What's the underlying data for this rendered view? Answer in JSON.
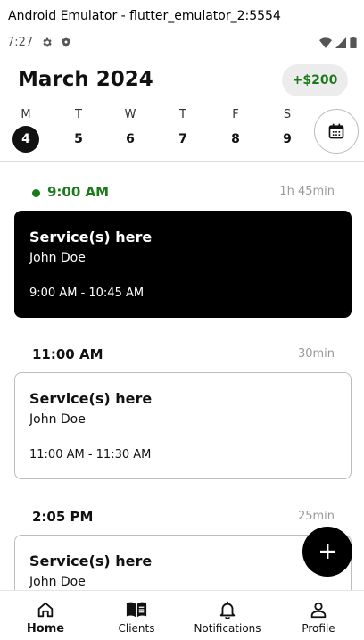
{
  "window": {
    "title": "Android Emulator - flutter_emulator_2:5554"
  },
  "status_bar": {
    "time": "7:27",
    "icons": [
      "gear-icon",
      "shield-icon",
      "wifi-icon",
      "signal-icon",
      "battery-icon"
    ]
  },
  "header": {
    "month": "March 2024",
    "balance": "+$200"
  },
  "week": {
    "days": [
      {
        "letter": "M",
        "num": "4",
        "active": true
      },
      {
        "letter": "T",
        "num": "5"
      },
      {
        "letter": "W",
        "num": "6"
      },
      {
        "letter": "T",
        "num": "7"
      },
      {
        "letter": "F",
        "num": "8"
      },
      {
        "letter": "S",
        "num": "9"
      }
    ],
    "calendar_icon": "calendar-icon"
  },
  "appointments": [
    {
      "time": "9:00 AM",
      "duration": "1h 45min",
      "service": "Service(s) here",
      "client": "John Doe",
      "range": "9:00 AM - 10:45 AM",
      "current": true
    },
    {
      "time": "11:00 AM",
      "duration": "30min",
      "service": "Service(s) here",
      "client": "John Doe",
      "range": "11:00 AM - 11:30 AM"
    },
    {
      "time": "2:05 PM",
      "duration": "25min",
      "service": "Service(s) here",
      "client": "John Doe"
    }
  ],
  "fab": {
    "icon": "plus-icon"
  },
  "nav": [
    {
      "label": "Home",
      "icon": "home-icon"
    },
    {
      "label": "Clients",
      "icon": "book-icon"
    },
    {
      "label": "Notifications",
      "icon": "bell-icon"
    },
    {
      "label": "Profile",
      "icon": "person-icon"
    }
  ],
  "colors": {
    "accent_green": "#1a7a1a",
    "primary": "#000000",
    "chip_bg": "#ececec"
  }
}
